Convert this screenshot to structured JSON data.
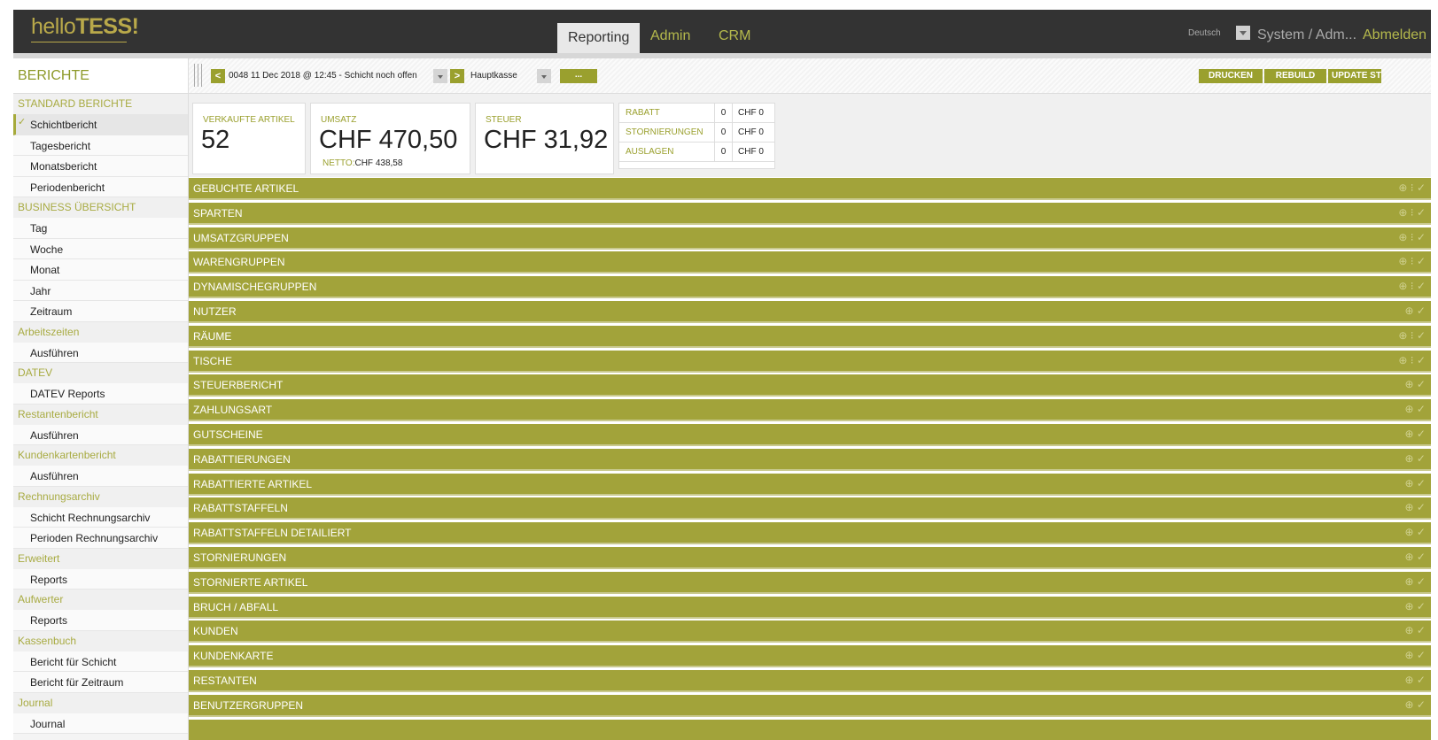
{
  "header": {
    "logo_light": "hello",
    "logo_bold": "TESS!",
    "nav": [
      {
        "label": "Reporting",
        "active": true
      },
      {
        "label": "Admin",
        "active": false
      },
      {
        "label": "CRM",
        "active": false
      }
    ],
    "language": "Deutsch",
    "user": "System / Adm...",
    "logout": "Abmelden"
  },
  "sidebar": {
    "title": "BERICHTE",
    "groups": [
      {
        "title": "STANDARD BERICHTE",
        "items": [
          "Schichtbericht",
          "Tagesbericht",
          "Monatsbericht",
          "Periodenbericht"
        ]
      },
      {
        "title": "BUSINESS ÜBERSICHT",
        "items": [
          "Tag",
          "Woche",
          "Monat",
          "Jahr",
          "Zeitraum"
        ]
      },
      {
        "title": "Arbeitszeiten",
        "items": [
          "Ausführen"
        ]
      },
      {
        "title": "DATEV",
        "items": [
          "DATEV Reports"
        ]
      },
      {
        "title": "Restantenbericht",
        "items": [
          "Ausführen"
        ]
      },
      {
        "title": "Kundenkartenbericht",
        "items": [
          "Ausführen"
        ]
      },
      {
        "title": "Rechnungsarchiv",
        "items": [
          "Schicht Rechnungsarchiv",
          "Perioden Rechnungsarchiv"
        ]
      },
      {
        "title": "Erweitert",
        "items": [
          "Reports"
        ]
      },
      {
        "title": "Aufwerter",
        "items": [
          "Reports"
        ]
      },
      {
        "title": "Kassenbuch",
        "items": [
          "Bericht für Schicht",
          "Bericht für Zeitraum"
        ]
      },
      {
        "title": "Journal",
        "items": [
          "Journal"
        ]
      }
    ],
    "selected": "Schichtbericht"
  },
  "toolbar": {
    "prev": "<",
    "next": ">",
    "shift": "0048 11 Dec 2018 @ 12:45 - Schicht noch offen",
    "register": "Hauptkasse",
    "more": "...",
    "print": "DRUCKEN",
    "rebuild": "REBUILD",
    "update": "UPDATE ST"
  },
  "summary": {
    "sold_label": "VERKAUFTE ARTIKEL",
    "sold_value": "52",
    "revenue_label": "UMSATZ",
    "revenue_value": "CHF 470,50",
    "netto_label": "NETTO:",
    "netto_value": "CHF 438,58",
    "tax_label": "STEUER",
    "tax_value": "CHF 31,92",
    "mini": [
      {
        "label": "RABATT",
        "count": "0",
        "value": "CHF 0"
      },
      {
        "label": "STORNIERUNGEN",
        "count": "0",
        "value": "CHF 0"
      },
      {
        "label": "AUSLAGEN",
        "count": "0",
        "value": "CHF 0"
      }
    ]
  },
  "sections": [
    {
      "title": "GEBUCHTE ARTIKEL",
      "icons": "⊕ ⁝ ✓"
    },
    {
      "title": "SPARTEN",
      "icons": "⊕ ⁝ ✓"
    },
    {
      "title": "UMSATZGRUPPEN",
      "icons": "⊕ ⁝ ✓"
    },
    {
      "title": "WARENGRUPPEN",
      "icons": "⊕ ⁝ ✓"
    },
    {
      "title": "DYNAMISCHEGRUPPEN",
      "icons": "⊕ ⁝ ✓"
    },
    {
      "title": "NUTZER",
      "icons": "⊕ ✓"
    },
    {
      "title": "RÄUME",
      "icons": "⊕ ⁝ ✓"
    },
    {
      "title": "TISCHE",
      "icons": "⊕ ⁝ ✓"
    },
    {
      "title": "STEUERBERICHT",
      "icons": "⊕ ✓"
    },
    {
      "title": "ZAHLUNGSART",
      "icons": "⊕ ✓"
    },
    {
      "title": "GUTSCHEINE",
      "icons": "⊕ ✓"
    },
    {
      "title": "RABATTIERUNGEN",
      "icons": "⊕ ✓"
    },
    {
      "title": "RABATTIERTE ARTIKEL",
      "icons": "⊕ ✓"
    },
    {
      "title": "RABATTSTAFFELN",
      "icons": "⊕ ✓"
    },
    {
      "title": "RABATTSTAFFELN DETAILIERT",
      "icons": "⊕ ✓"
    },
    {
      "title": "STORNIERUNGEN",
      "icons": "⊕ ✓"
    },
    {
      "title": "STORNIERTE ARTIKEL",
      "icons": "⊕ ✓"
    },
    {
      "title": "BRUCH / ABFALL",
      "icons": "⊕ ✓"
    },
    {
      "title": "KUNDEN",
      "icons": "⊕ ✓"
    },
    {
      "title": "KUNDENKARTE",
      "icons": "⊕ ✓"
    },
    {
      "title": "RESTANTEN",
      "icons": "⊕ ✓"
    },
    {
      "title": "BENUTZERGRUPPEN",
      "icons": "⊕ ✓"
    },
    {
      "title": "",
      "icons": ""
    }
  ],
  "colors": {
    "accent": "#a2a33a",
    "topbar": "#333333",
    "logo": "#b9a94a"
  }
}
